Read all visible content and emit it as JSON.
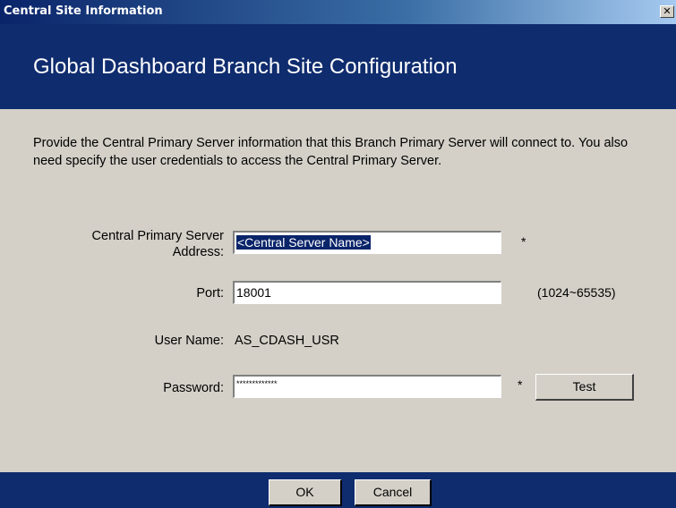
{
  "window": {
    "title": "Central Site Information",
    "close_glyph": "✕"
  },
  "header": {
    "title": "Global Dashboard Branch Site Configuration"
  },
  "intro": {
    "text": "Provide the Central Primary Server information that this Branch Primary Server will connect to. You also need specify the user credentials to access the Central Primary Server."
  },
  "form": {
    "server_label_line1": "Central Primary Server",
    "server_label_line2": "Address:",
    "server_value": "<Central Server Name>",
    "port_label": "Port:",
    "port_value": "18001",
    "port_range": "(1024~65535)",
    "username_label": "User Name:",
    "username_value": "AS_CDASH_USR",
    "password_label": "Password:",
    "password_value": "*************",
    "required_mark": "*",
    "test_label": "Test"
  },
  "footer": {
    "ok_label": "OK",
    "cancel_label": "Cancel"
  },
  "colors": {
    "header_band": "#0f2c6e",
    "titlebar_start": "#0a246a",
    "selection": "#0a246a",
    "dialog_bg": "#d4d0c8"
  },
  "icons": {
    "close": "close-icon"
  }
}
